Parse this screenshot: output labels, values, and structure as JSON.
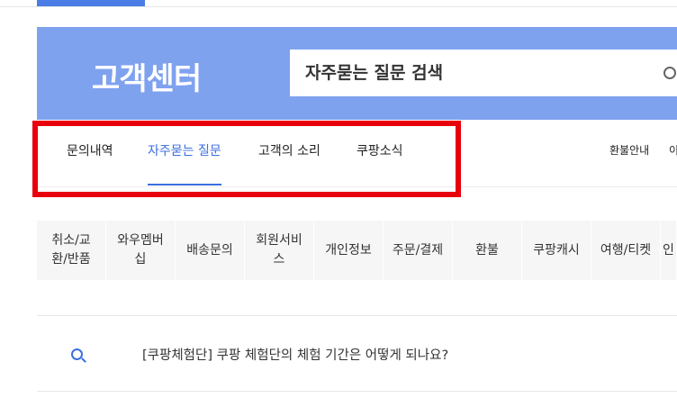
{
  "header": {
    "title": "고객센터",
    "search": {
      "placeholder": "자주묻는 질문 검색",
      "value": ""
    }
  },
  "tabs": [
    {
      "label": "문의내역",
      "active": false
    },
    {
      "label": "자주묻는 질문",
      "active": true
    },
    {
      "label": "고객의 소리",
      "active": false
    },
    {
      "label": "쿠팡소식",
      "active": false
    }
  ],
  "right_links": [
    "환불안내",
    "이"
  ],
  "categories": [
    {
      "label": "취소/교\n환/반품"
    },
    {
      "label": "와우멤버\n십"
    },
    {
      "label": "배송문의"
    },
    {
      "label": "회원서비\n스"
    },
    {
      "label": "개인정보"
    },
    {
      "label": "주문/결제"
    },
    {
      "label": "환불"
    },
    {
      "label": "쿠팡캐시"
    },
    {
      "label": "여행/티켓"
    },
    {
      "label": "인"
    }
  ],
  "faq": [
    {
      "question": "[쿠팡체험단] 쿠팡 체험단의 체험 기간은 어떻게 되나요?"
    }
  ],
  "colors": {
    "banner": "#7fa2ef",
    "accent": "#3b6fe0",
    "highlight": "#e8000b",
    "category_bg": "#f6f6f6"
  },
  "icons": {
    "search": "search-icon",
    "faq": "question-icon"
  }
}
